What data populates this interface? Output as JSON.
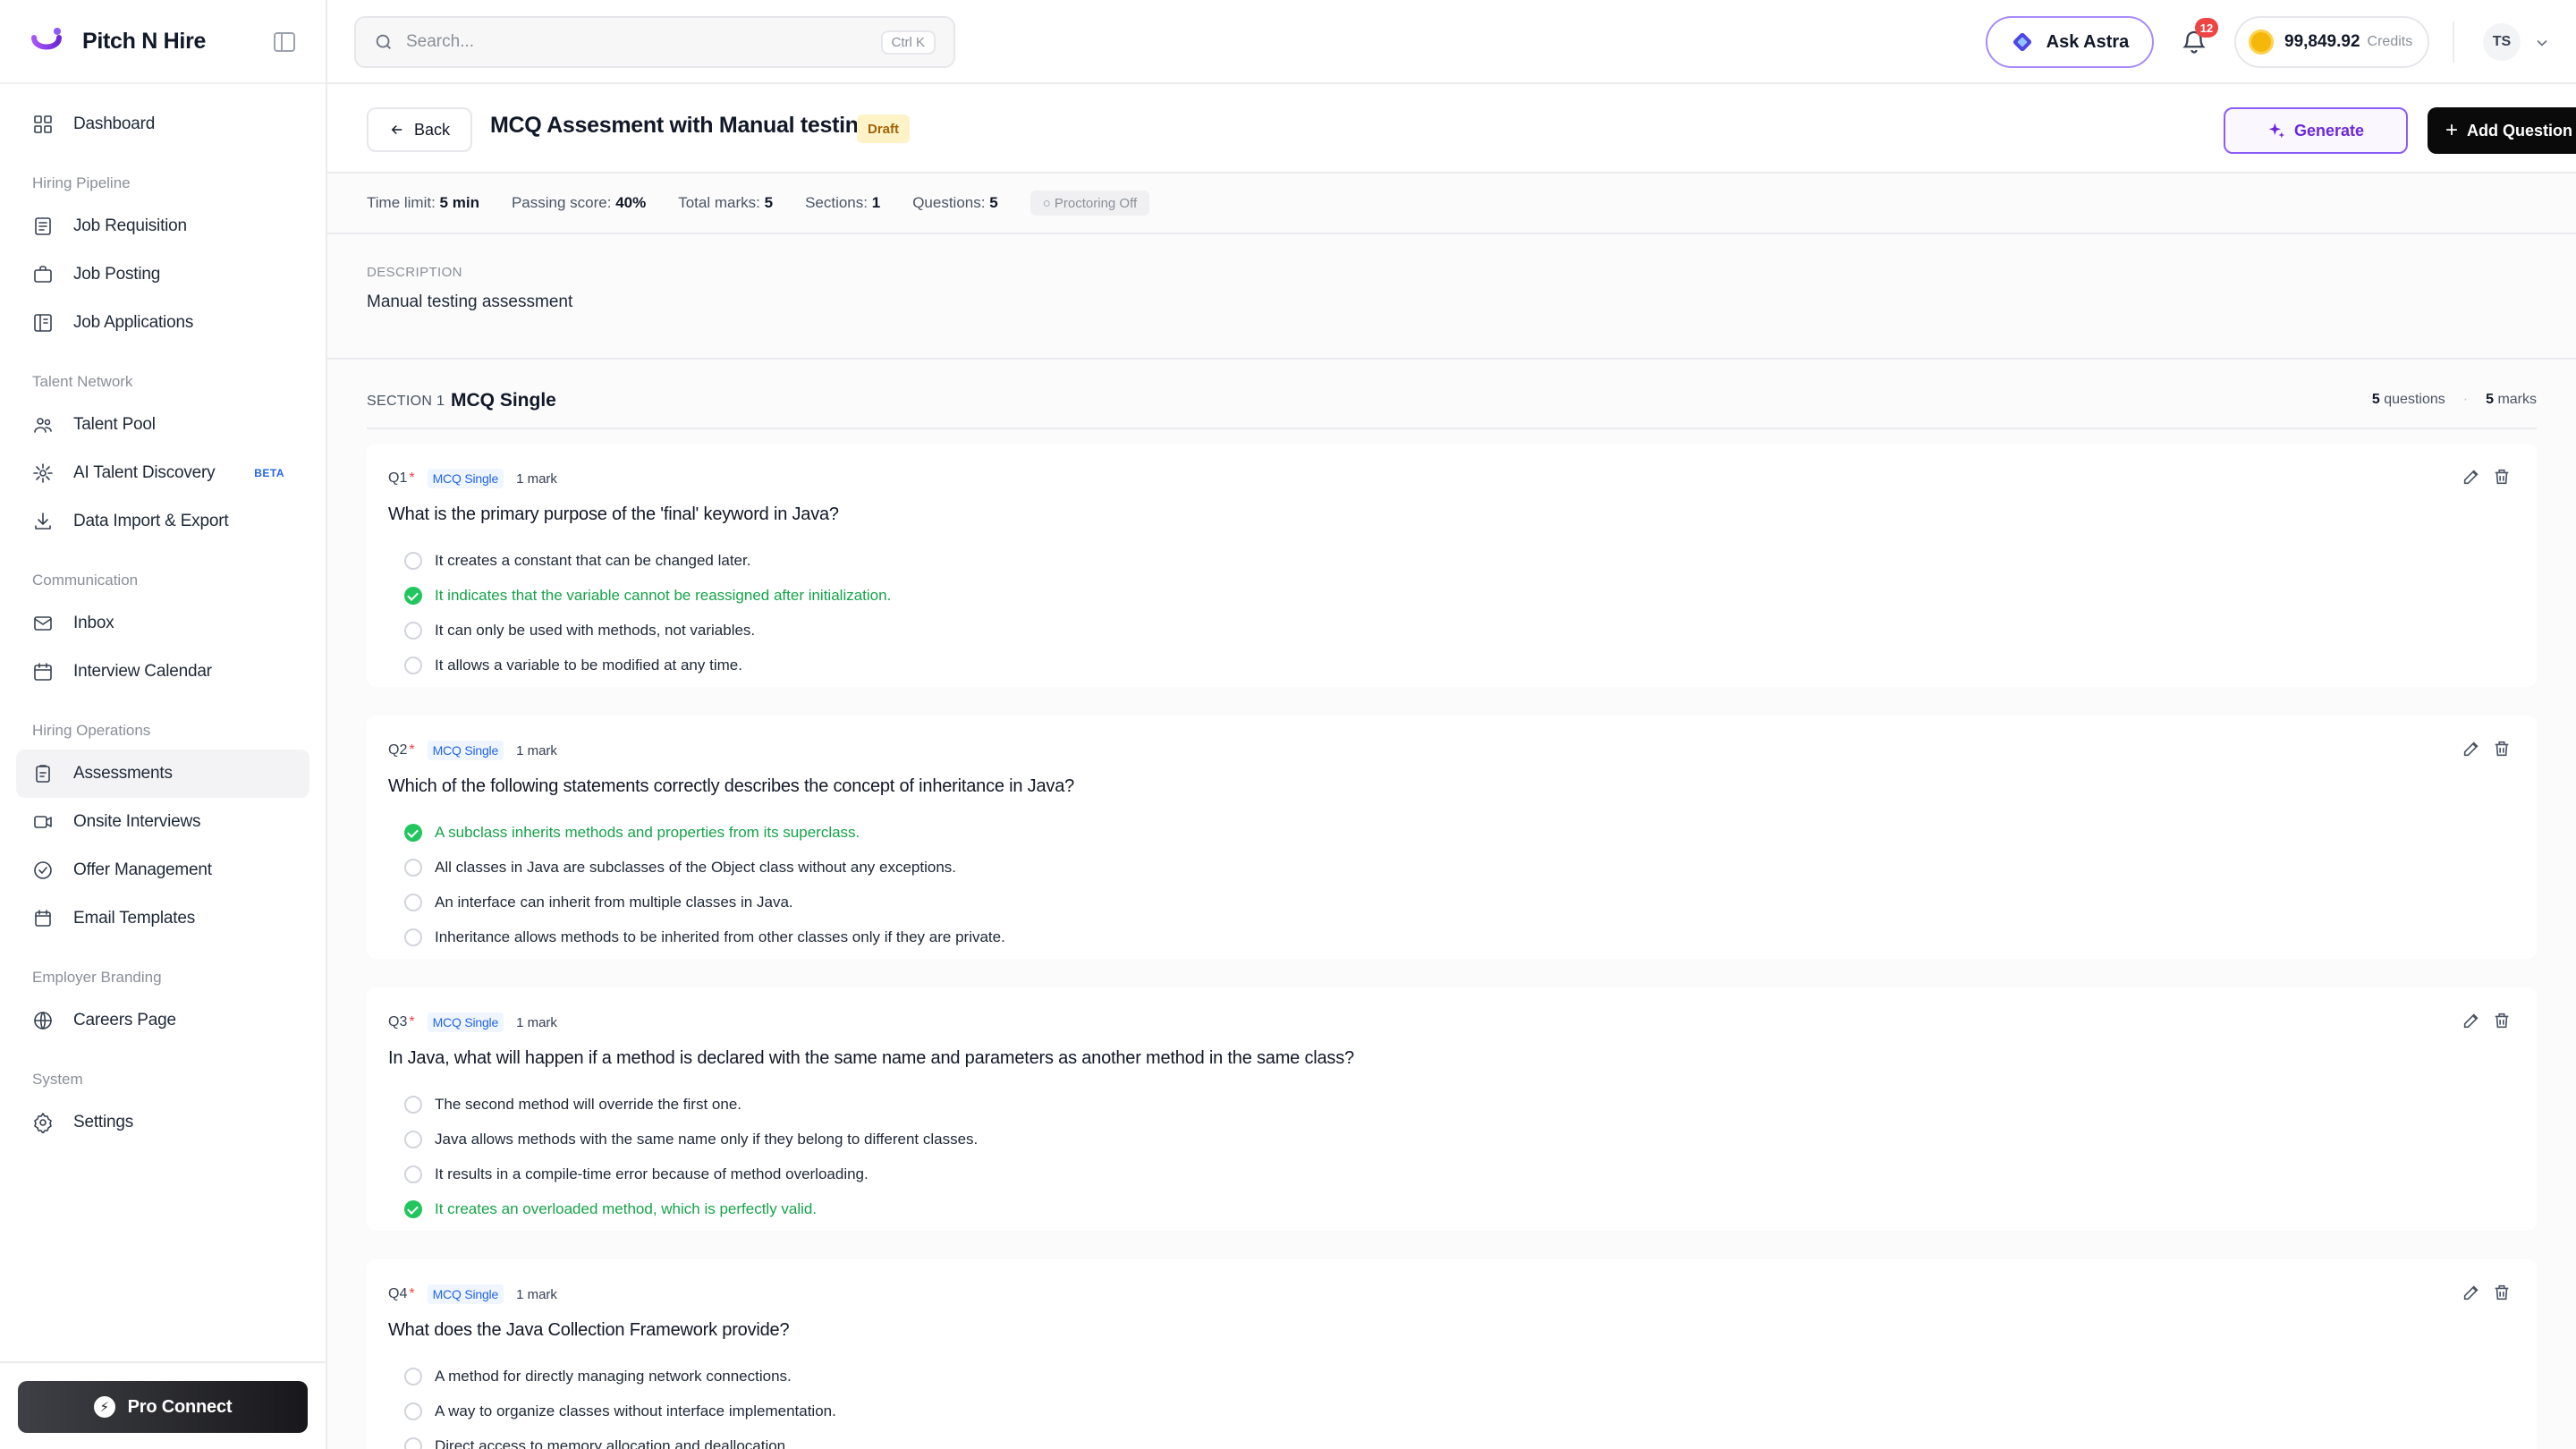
{
  "brand": {
    "name": "Pitch N Hire"
  },
  "sidebar": {
    "top_items": [
      {
        "label": "Dashboard",
        "icon": "dashboard-icon"
      }
    ],
    "groups": [
      {
        "label": "Hiring Pipeline",
        "items": [
          {
            "label": "Job Requisition",
            "icon": "requisition-icon"
          },
          {
            "label": "Job Posting",
            "icon": "posting-icon"
          },
          {
            "label": "Job Applications",
            "icon": "applications-icon"
          }
        ]
      },
      {
        "label": "Talent Network",
        "items": [
          {
            "label": "Talent Pool",
            "icon": "talent-pool-icon"
          },
          {
            "label": "AI Talent Discovery",
            "icon": "ai-discovery-icon",
            "badge": "BETA"
          },
          {
            "label": "Data Import & Export",
            "icon": "import-export-icon"
          }
        ]
      },
      {
        "label": "Communication",
        "items": [
          {
            "label": "Inbox",
            "icon": "inbox-icon"
          },
          {
            "label": "Interview Calendar",
            "icon": "calendar-icon"
          }
        ]
      },
      {
        "label": "Hiring Operations",
        "items": [
          {
            "label": "Assessments",
            "icon": "assessments-icon",
            "active": true
          },
          {
            "label": "Onsite Interviews",
            "icon": "video-icon"
          },
          {
            "label": "Offer Management",
            "icon": "offer-icon"
          },
          {
            "label": "Email Templates",
            "icon": "email-templates-icon"
          }
        ]
      },
      {
        "label": "Employer Branding",
        "items": [
          {
            "label": "Careers Page",
            "icon": "globe-icon"
          }
        ]
      },
      {
        "label": "System",
        "items": [
          {
            "label": "Settings",
            "icon": "gear-icon"
          }
        ]
      }
    ],
    "pro_connect": "Pro Connect"
  },
  "topbar": {
    "search_placeholder": "Search...",
    "search_shortcut": "Ctrl K",
    "ask_astra": "Ask Astra",
    "notifications_count": "12",
    "credits_value": "99,849.92",
    "credits_label": "Credits",
    "user_initials": "TS"
  },
  "header": {
    "back_label": "Back",
    "title": "MCQ Assesment with Manual testing",
    "status": "Draft",
    "generate_label": "Generate",
    "add_question_label": "Add Question"
  },
  "stats": {
    "time_limit_label": "Time limit:",
    "time_limit": "5 min",
    "passing_label": "Passing score:",
    "passing": "40%",
    "total_marks_label": "Total marks:",
    "total_marks": "5",
    "sections_label": "Sections:",
    "sections": "1",
    "questions_label": "Questions:",
    "questions": "5",
    "proctoring": "○ Proctoring Off"
  },
  "description": {
    "label": "DESCRIPTION",
    "text": "Manual testing assessment"
  },
  "section": {
    "number": "SECTION 1",
    "name": "MCQ Single",
    "question_count": "5",
    "question_count_label": "questions",
    "marks": "5",
    "marks_label": "marks"
  },
  "questions": [
    {
      "num": "Q1",
      "type": "MCQ Single",
      "marks": "1 mark",
      "text": "What is the primary purpose of the 'final' keyword in Java?",
      "options": [
        {
          "text": "It creates a constant that can be changed later.",
          "correct": false
        },
        {
          "text": "It indicates that the variable cannot be reassigned after initialization.",
          "correct": true
        },
        {
          "text": "It can only be used with methods, not variables.",
          "correct": false
        },
        {
          "text": "It allows a variable to be modified at any time.",
          "correct": false
        }
      ]
    },
    {
      "num": "Q2",
      "type": "MCQ Single",
      "marks": "1 mark",
      "text": "Which of the following statements correctly describes the concept of inheritance in Java?",
      "options": [
        {
          "text": "A subclass inherits methods and properties from its superclass.",
          "correct": true
        },
        {
          "text": "All classes in Java are subclasses of the Object class without any exceptions.",
          "correct": false
        },
        {
          "text": "An interface can inherit from multiple classes in Java.",
          "correct": false
        },
        {
          "text": "Inheritance allows methods to be inherited from other classes only if they are private.",
          "correct": false
        }
      ]
    },
    {
      "num": "Q3",
      "type": "MCQ Single",
      "marks": "1 mark",
      "text": "In Java, what will happen if a method is declared with the same name and parameters as another method in the same class?",
      "options": [
        {
          "text": "The second method will override the first one.",
          "correct": false
        },
        {
          "text": "Java allows methods with the same name only if they belong to different classes.",
          "correct": false
        },
        {
          "text": "It results in a compile-time error because of method overloading.",
          "correct": false
        },
        {
          "text": "It creates an overloaded method, which is perfectly valid.",
          "correct": true
        }
      ]
    },
    {
      "num": "Q4",
      "type": "MCQ Single",
      "marks": "1 mark",
      "text": "What does the Java Collection Framework provide?",
      "options": [
        {
          "text": "A method for directly managing network connections.",
          "correct": false
        },
        {
          "text": "A way to organize classes without interface implementation.",
          "correct": false
        },
        {
          "text": "Direct access to memory allocation and deallocation.",
          "correct": false
        }
      ]
    }
  ],
  "colors": {
    "accent": "#7c5cf0",
    "correct": "#16a34a",
    "draft": "#fef3c7",
    "badge": "#ef4444"
  }
}
